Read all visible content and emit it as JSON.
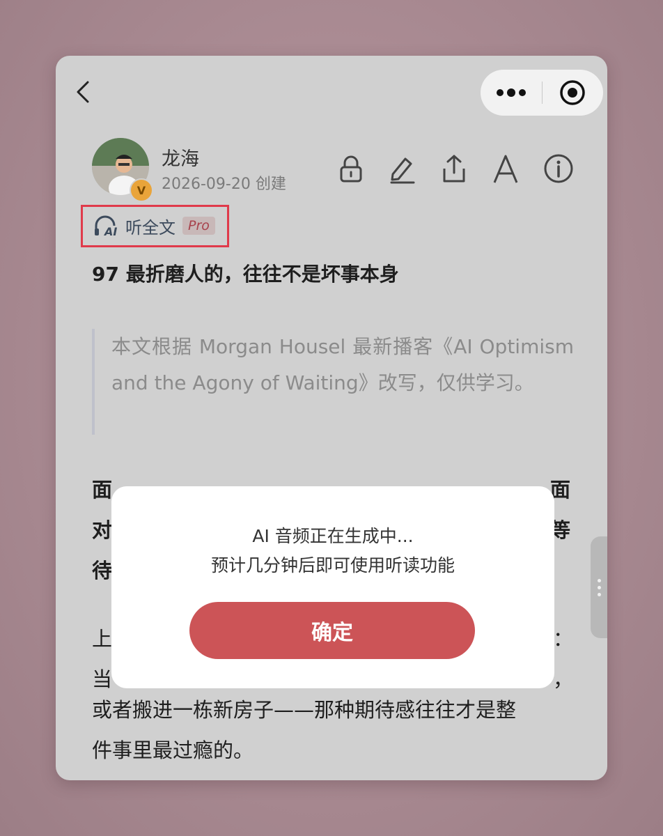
{
  "nav": {
    "back_icon": "chevron-left-icon",
    "more_icon": "more-dots-icon",
    "close_icon": "target-close-icon"
  },
  "author": {
    "name": "龙海",
    "date": "2026-09-20 创建",
    "badge": "V"
  },
  "toolbar": {
    "icons": [
      "lock-icon",
      "edit-pen-icon",
      "share-icon",
      "font-a-icon",
      "info-icon"
    ]
  },
  "listen": {
    "icon": "ai-headphones-icon",
    "label": "听全文",
    "pro": "Pro",
    "highlight_color": "#e03a4a"
  },
  "article": {
    "title": "97 最折磨人的，往往不是坏事本身",
    "quote": "本文根据 Morgan Housel 最新播客《AI Optimism and the Agony of Waiting》改写，仅供学习。",
    "para1_lines": [
      "面",
      "对",
      "待"
    ],
    "para1_tail": [
      "面",
      "等"
    ],
    "para2_heads": [
      "上",
      "当"
    ],
    "para2_tails": [
      "：",
      "，"
    ],
    "para2_lines": [
      "或者搬进一栋新房子——那种期待感往往才是整",
      "件事里最过瘾的。"
    ]
  },
  "modal": {
    "line1": "AI 音频正在生成中...",
    "line2": "预计几分钟后即可使用听读功能",
    "confirm_label": "确定",
    "button_color": "#cc5457"
  }
}
